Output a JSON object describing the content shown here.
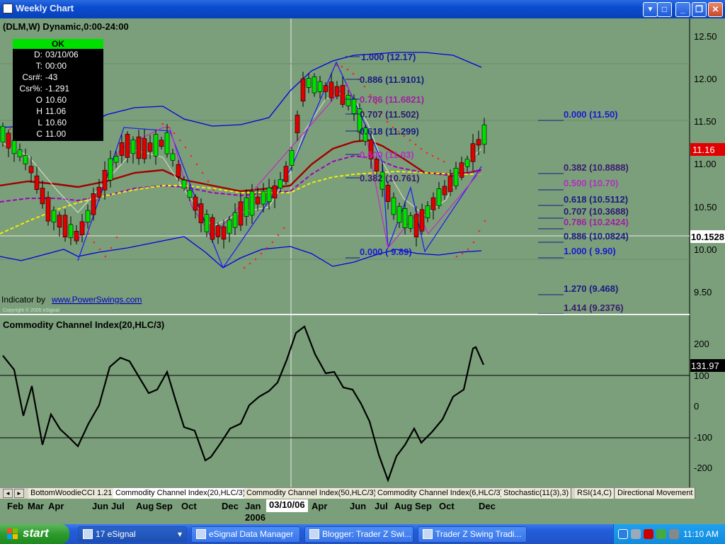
{
  "window": {
    "title": "Weekly Chart",
    "buttons": {
      "help": "▼",
      "restore_sym": "□",
      "minimize": "_",
      "maximize": "❐",
      "close": "✕"
    }
  },
  "chart": {
    "symbol_line": "(DLM,W) Dynamic,0:00-24:00",
    "indicator_text": "Indicator by",
    "indicator_link": "www.PowerSwings.com",
    "copyright": "Copyright © 2005 eSignal",
    "cci_title": "Commodity Channel Index(20,HLC/3)",
    "price_axis": [
      "12.50",
      "12.00",
      "11.50",
      "11.00",
      "10.50",
      "10.00",
      "9.50"
    ],
    "cci_axis": [
      "200",
      "100",
      "0",
      "-100",
      "-200"
    ],
    "last_price": "11.16",
    "cursor_price": "10.1528",
    "cci_last": "131.97",
    "fib_inner": [
      {
        "text": "1.000 (12.17)",
        "color": "#1a1aa0"
      },
      {
        "text": "0.886 (11.9101)",
        "color": "#1a1a80"
      },
      {
        "text": "0.786 (11.6821)",
        "color": "#a020a0"
      },
      {
        "text": "0.707 (11.502)",
        "color": "#2a1a70"
      },
      {
        "text": "0.618 (11.299)",
        "color": "#1a1a80"
      },
      {
        "text": "0.500 (11.03)",
        "color": "#b030c0"
      },
      {
        "text": "0.382 (10.761)",
        "color": "#3a1a70"
      },
      {
        "text": "0.000 ( 9.89)",
        "color": "#1a1ad0"
      }
    ],
    "fib_outer": [
      {
        "text": "0.000 (11.50)",
        "color": "#1a1ad0"
      },
      {
        "text": "0.382 (10.8888)",
        "color": "#3a1a70"
      },
      {
        "text": "0.500 (10.70)",
        "color": "#b030c0"
      },
      {
        "text": "0.618 (10.5112)",
        "color": "#1a1a80"
      },
      {
        "text": "0.707 (10.3688)",
        "color": "#2a1a70"
      },
      {
        "text": "0.786 (10.2424)",
        "color": "#a020a0"
      },
      {
        "text": "0.886 (10.0824)",
        "color": "#1a1a80"
      },
      {
        "text": "1.000 ( 9.90)",
        "color": "#1a1ad0"
      },
      {
        "text": "1.270 (9.468)",
        "color": "#1a1a80"
      },
      {
        "text": "1.414 (9.2376)",
        "color": "#3a1a70"
      }
    ],
    "info_box": {
      "status": "OK",
      "rows": [
        {
          "k": "D:",
          "v": "03/10/06"
        },
        {
          "k": "T:",
          "v": "00:00"
        },
        {
          "k": "Csr#:",
          "v": "-43"
        },
        {
          "k": "Csr%:",
          "v": "-1.291"
        },
        {
          "k": "O",
          "v": "10.60"
        },
        {
          "k": "H",
          "v": "11.06"
        },
        {
          "k": "L",
          "v": "10.60"
        },
        {
          "k": "C",
          "v": "11.00"
        }
      ]
    }
  },
  "tabs": [
    "BottomWoodieCCI 1.21",
    "Commodity Channel Index(20,HLC/3)",
    "Commodity Channel Index(50,HLC/3)",
    "Commodity Channel Index(6,HLC/3)",
    "Stochastic(11(3),3)",
    "RSI(14,C)",
    "Directional Movement"
  ],
  "x_axis": {
    "labels": [
      "Feb",
      "Mar",
      "Apr",
      "Jun",
      "Jul",
      "Aug",
      "Sep",
      "Oct",
      "Dec",
      "Jan",
      "Apr",
      "Jun",
      "Jul",
      "Aug",
      "Sep",
      "Oct",
      "Dec"
    ],
    "year": "2006",
    "cursor_date": "03/10/06"
  },
  "taskbar": {
    "start": "start",
    "tasks": [
      "17 eSignal",
      "eSignal Data Manager",
      "Blogger: Trader Z Swi...",
      "Trader Z Swing Tradi..."
    ],
    "clock": "11:10 AM"
  },
  "colors": {
    "background": "#7b9f7b",
    "bull_candle": "#00e000",
    "bear_candle": "#e00000",
    "bollinger": "#0000e0",
    "ma_red": "#a00000",
    "ma_yellow": "#f0f000",
    "ma_purple": "#a000c0",
    "sar_dots": "#ff0000"
  }
}
